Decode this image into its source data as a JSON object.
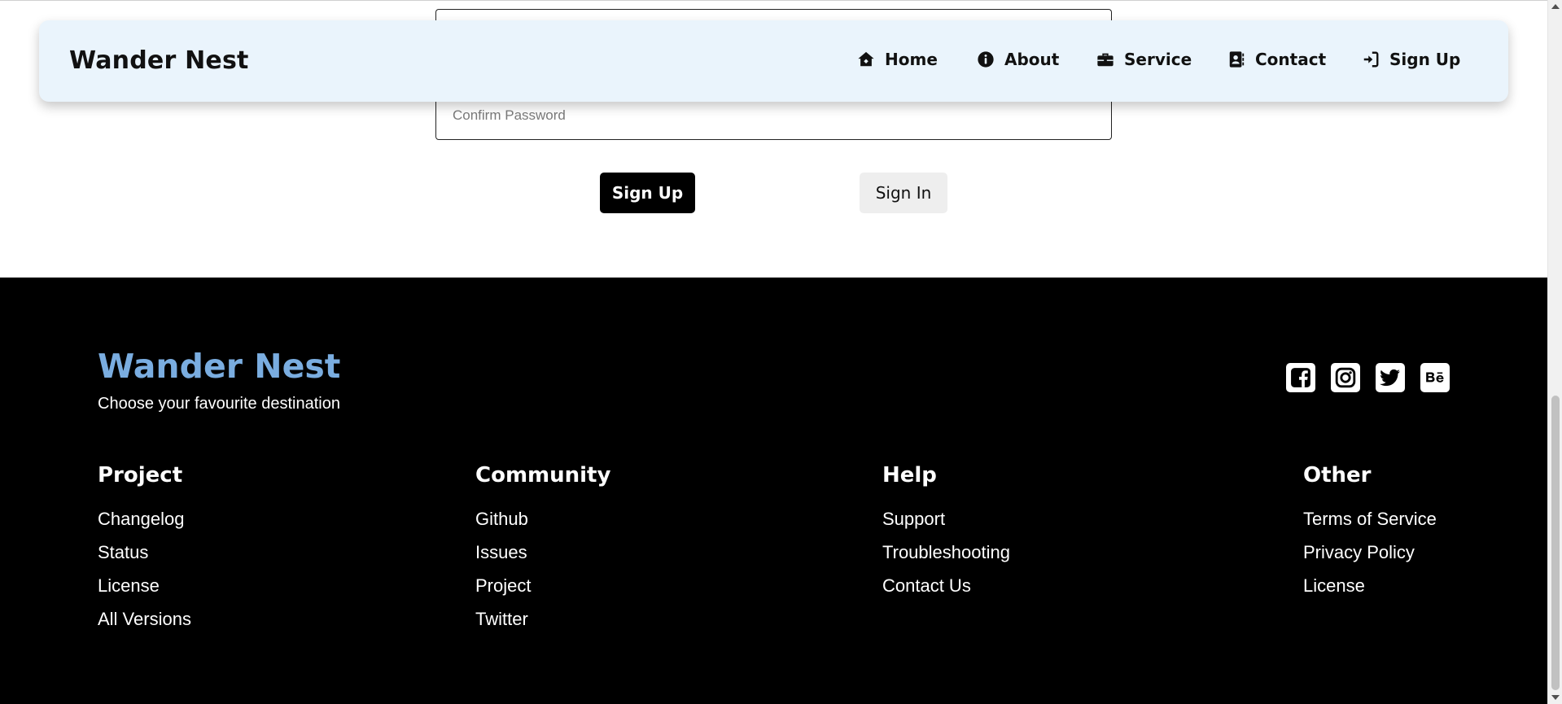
{
  "navbar": {
    "brand": "Wander Nest",
    "items": [
      {
        "label": "Home",
        "icon": "home-icon"
      },
      {
        "label": "About",
        "icon": "info-icon"
      },
      {
        "label": "Service",
        "icon": "briefcase-icon"
      },
      {
        "label": "Contact",
        "icon": "contact-book-icon"
      },
      {
        "label": "Sign Up",
        "icon": "sign-in-icon"
      }
    ]
  },
  "form": {
    "confirm_password_placeholder": "Confirm Password",
    "signup_label": "Sign Up",
    "signin_label": "Sign In"
  },
  "footer": {
    "brand": "Wander Nest",
    "brand_color": "#7aade0",
    "tagline": "Choose your favourite destination",
    "social": [
      "facebook-icon",
      "instagram-icon",
      "twitter-icon",
      "behance-icon"
    ],
    "columns": [
      {
        "title": "Project",
        "links": [
          "Changelog",
          "Status",
          "License",
          "All Versions"
        ]
      },
      {
        "title": "Community",
        "links": [
          "Github",
          "Issues",
          "Project",
          "Twitter"
        ]
      },
      {
        "title": "Help",
        "links": [
          "Support",
          "Troubleshooting",
          "Contact Us"
        ]
      },
      {
        "title": "Other",
        "links": [
          "Terms of Service",
          "Privacy Policy",
          "License"
        ]
      }
    ]
  }
}
